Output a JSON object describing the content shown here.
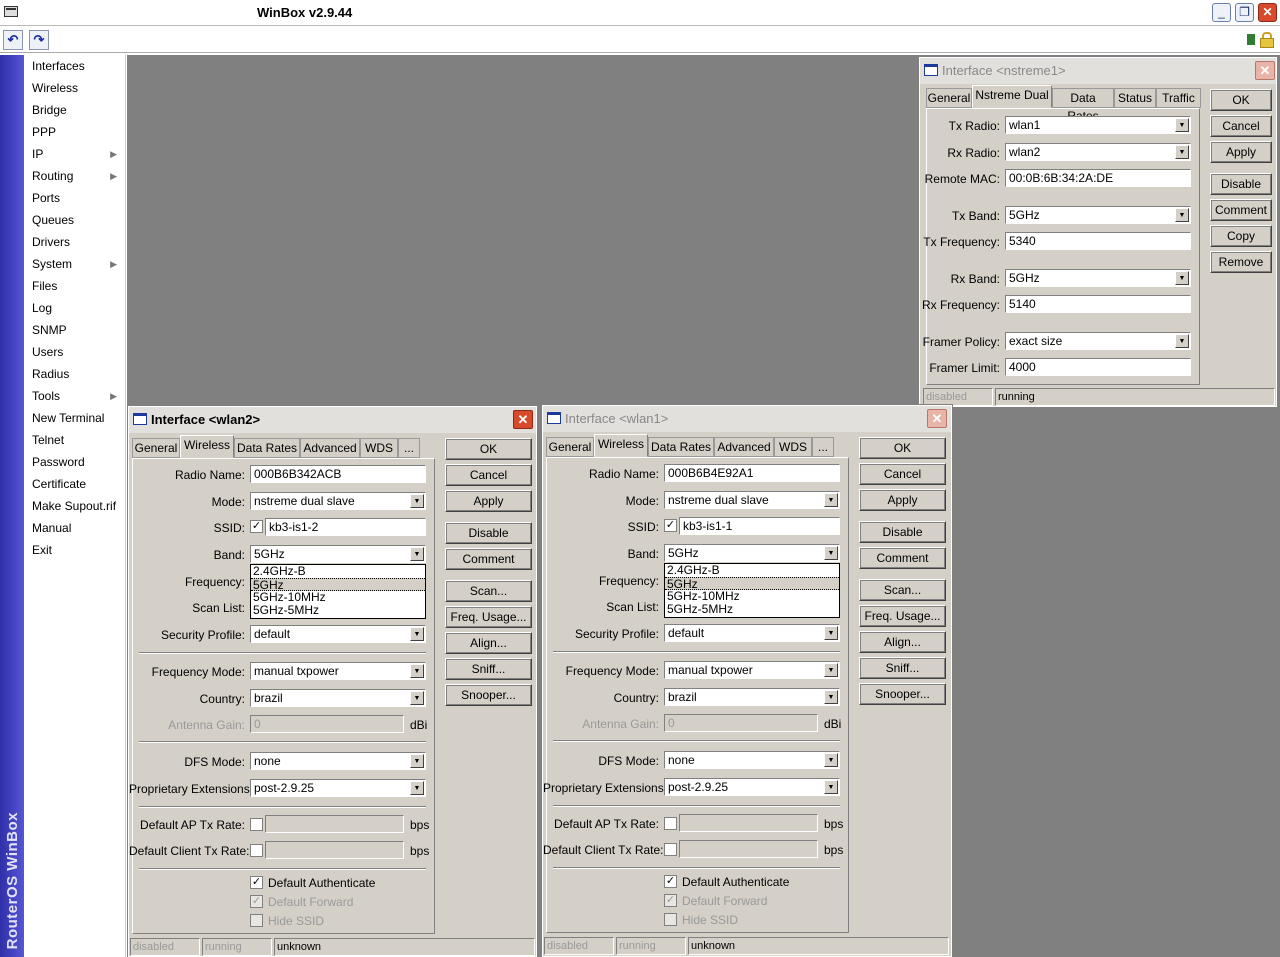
{
  "app": {
    "title": "WinBox v2.9.44",
    "brand_vertical": "RouterOS WinBox"
  },
  "menu": [
    {
      "label": "Interfaces"
    },
    {
      "label": "Wireless"
    },
    {
      "label": "Bridge"
    },
    {
      "label": "PPP"
    },
    {
      "label": "IP",
      "submenu": true
    },
    {
      "label": "Routing",
      "submenu": true
    },
    {
      "label": "Ports"
    },
    {
      "label": "Queues"
    },
    {
      "label": "Drivers"
    },
    {
      "label": "System",
      "submenu": true
    },
    {
      "label": "Files"
    },
    {
      "label": "Log"
    },
    {
      "label": "SNMP"
    },
    {
      "label": "Users"
    },
    {
      "label": "Radius"
    },
    {
      "label": "Tools",
      "submenu": true
    },
    {
      "label": "New Terminal"
    },
    {
      "label": "Telnet"
    },
    {
      "label": "Password"
    },
    {
      "label": "Certificate"
    },
    {
      "label": "Make Supout.rif"
    },
    {
      "label": "Manual"
    },
    {
      "label": "Exit"
    }
  ],
  "nstreme": {
    "title": "Interface <nstreme1>",
    "tabs": [
      "General",
      "Nstreme Dual",
      "Data Rates",
      "Status",
      "Traffic"
    ],
    "labels": {
      "tx_radio": "Tx Radio:",
      "rx_radio": "Rx Radio:",
      "remote_mac": "Remote MAC:",
      "tx_band": "Tx Band:",
      "tx_freq": "Tx Frequency:",
      "rx_band": "Rx Band:",
      "rx_freq": "Rx Frequency:",
      "framer_policy": "Framer Policy:",
      "framer_limit": "Framer Limit:"
    },
    "values": {
      "tx_radio": "wlan1",
      "rx_radio": "wlan2",
      "remote_mac": "00:0B:6B:34:2A:DE",
      "tx_band": "5GHz",
      "tx_freq": "5340",
      "rx_band": "5GHz",
      "rx_freq": "5140",
      "framer_policy": "exact size",
      "framer_limit": "4000"
    },
    "buttons": [
      "OK",
      "Cancel",
      "Apply",
      "Disable",
      "Comment",
      "Copy",
      "Remove"
    ],
    "status": [
      "disabled",
      "running"
    ]
  },
  "wlan2": {
    "title": "Interface <wlan2>",
    "tabs": [
      "General",
      "Wireless",
      "Data Rates",
      "Advanced",
      "WDS",
      "..."
    ],
    "labels": {
      "radio_name": "Radio Name:",
      "mode": "Mode:",
      "ssid": "SSID:",
      "band": "Band:",
      "frequency": "Frequency:",
      "scan_list": "Scan List:",
      "security_profile": "Security Profile:",
      "frequency_mode": "Frequency Mode:",
      "country": "Country:",
      "antenna_gain": "Antenna Gain:",
      "dfs_mode": "DFS Mode:",
      "prop_ext": "Proprietary Extensions:",
      "ap_tx_rate": "Default AP Tx Rate:",
      "client_tx_rate": "Default Client Tx Rate:"
    },
    "values": {
      "radio_name": "000B6B342ACB",
      "mode": "nstreme dual slave",
      "ssid": "kb3-is1-2",
      "band": "5GHz",
      "security_profile": "default",
      "frequency_mode": "manual txpower",
      "country": "brazil",
      "antenna_gain": "0",
      "dfs_mode": "none",
      "prop_ext": "post-2.9.25"
    },
    "band_options": [
      "2.4GHz-B",
      "5GHz",
      "5GHz-10MHz",
      "5GHz-5MHz"
    ],
    "units": {
      "dbi": "dBi",
      "bps": "bps"
    },
    "checks": {
      "default_auth": "Default Authenticate",
      "default_forward": "Default Forward",
      "hide_ssid": "Hide SSID"
    },
    "buttons": [
      "OK",
      "Cancel",
      "Apply",
      "Disable",
      "Comment",
      "Scan...",
      "Freq. Usage...",
      "Align...",
      "Sniff...",
      "Snooper..."
    ],
    "status": [
      "disabled",
      "running",
      "unknown"
    ]
  },
  "wlan1": {
    "title": "Interface <wlan1>",
    "tabs": [
      "General",
      "Wireless",
      "Data Rates",
      "Advanced",
      "WDS",
      "..."
    ],
    "labels": {
      "radio_name": "Radio Name:",
      "mode": "Mode:",
      "ssid": "SSID:",
      "band": "Band:",
      "frequency": "Frequency:",
      "scan_list": "Scan List:",
      "security_profile": "Security Profile:",
      "frequency_mode": "Frequency Mode:",
      "country": "Country:",
      "antenna_gain": "Antenna Gain:",
      "dfs_mode": "DFS Mode:",
      "prop_ext": "Proprietary Extensions:",
      "ap_tx_rate": "Default AP Tx Rate:",
      "client_tx_rate": "Default Client Tx Rate:"
    },
    "values": {
      "radio_name": "000B6B4E92A1",
      "mode": "nstreme dual slave",
      "ssid": "kb3-is1-1",
      "band": "5GHz",
      "security_profile": "default",
      "frequency_mode": "manual txpower",
      "country": "brazil",
      "antenna_gain": "0",
      "dfs_mode": "none",
      "prop_ext": "post-2.9.25"
    },
    "band_options": [
      "2.4GHz-B",
      "5GHz",
      "5GHz-10MHz",
      "5GHz-5MHz"
    ],
    "units": {
      "dbi": "dBi",
      "bps": "bps"
    },
    "checks": {
      "default_auth": "Default Authenticate",
      "default_forward": "Default Forward",
      "hide_ssid": "Hide SSID"
    },
    "buttons": [
      "OK",
      "Cancel",
      "Apply",
      "Disable",
      "Comment",
      "Scan...",
      "Freq. Usage...",
      "Align...",
      "Sniff...",
      "Snooper..."
    ],
    "status": [
      "disabled",
      "running",
      "unknown"
    ]
  }
}
